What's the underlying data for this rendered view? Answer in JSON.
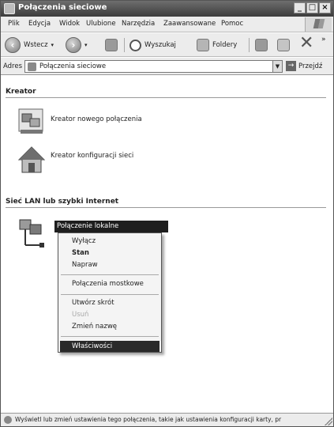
{
  "window": {
    "title": "Połączenia sieciowe",
    "buttons": [
      "_",
      "□",
      "×"
    ]
  },
  "menubar": {
    "items": [
      "Plik",
      "Edycja",
      "Widok",
      "Ulubione",
      "Narzędzia",
      "Zaawansowane",
      "Pomoc"
    ]
  },
  "toolbar": {
    "back_label": "Wstecz",
    "search_label": "Wyszukaj",
    "folders_label": "Foldery"
  },
  "address": {
    "label": "Adres",
    "value": "Połączenia sieciowe",
    "go_label": "Przejdź"
  },
  "sections": {
    "wizard_title": "Kreator",
    "wizard_items": [
      "Kreator nowego połączenia",
      "Kreator konfiguracji sieci"
    ],
    "lan_title": "Sieć LAN lub szybki Internet"
  },
  "context_menu": {
    "header": "Połączenie lokalne",
    "items": [
      "Wyłącz",
      "Stan",
      "Napraw",
      "Połączenia mostkowe",
      "Utwórz skrót",
      "Usuń",
      "Zmień nazwę",
      "Właściwości"
    ]
  },
  "statusbar": {
    "text": "Wyświetl lub zmień ustawienia tego połączenia, takie jak ustawienia konfiguracji karty, pr"
  },
  "icons": {
    "back": "back-arrow-icon",
    "forward": "forward-arrow-icon",
    "up": "folder-up-icon",
    "search": "search-icon",
    "folders": "folders-icon",
    "go": "go-arrow-icon"
  }
}
